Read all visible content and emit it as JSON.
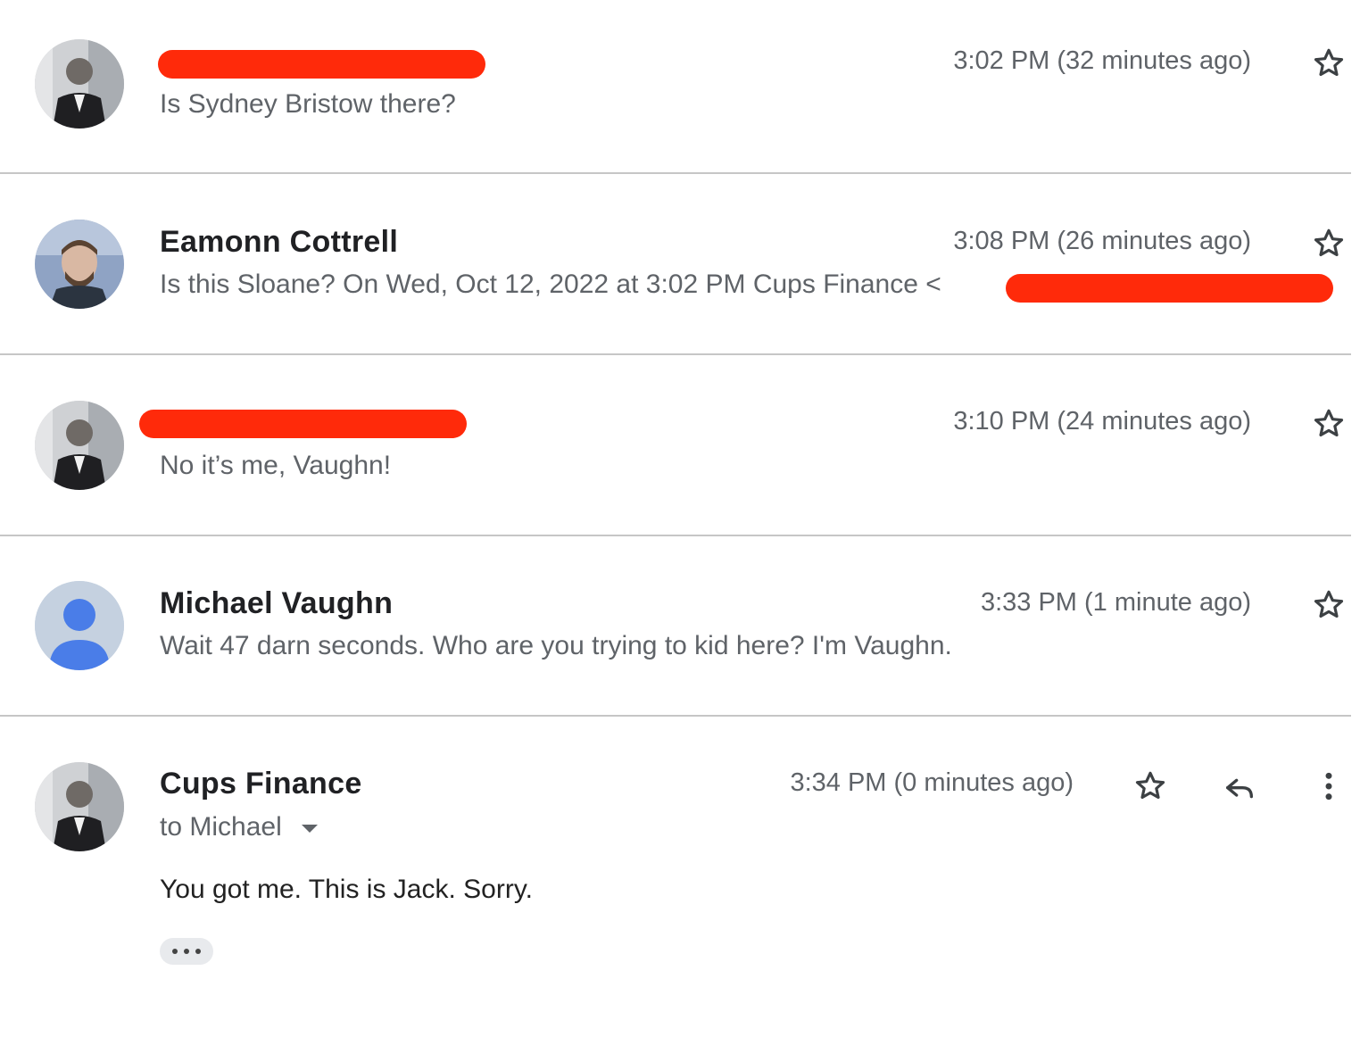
{
  "messages": [
    {
      "sender": "",
      "snippet": "Is Sydney Bristow there?",
      "time": "3:02 PM (32 minutes ago)",
      "avatar": "photo-icon",
      "sender_redacted": true
    },
    {
      "sender": "Eamonn Cottrell",
      "snippet": "Is this Sloane? On Wed, Oct 12, 2022 at 3:02 PM Cups Finance <",
      "time": "3:08 PM (26 minutes ago)",
      "avatar": "photo-icon",
      "email_redacted": true
    },
    {
      "sender": "",
      "snippet": "No it’s me, Vaughn!",
      "time": "3:10 PM (24 minutes ago)",
      "avatar": "photo-icon",
      "sender_redacted": true
    },
    {
      "sender": "Michael Vaughn",
      "snippet": "Wait 47 darn seconds. Who are you trying to kid here? I'm Vaughn.",
      "time": "3:33 PM (1 minute ago)",
      "avatar": "default-person-icon"
    },
    {
      "sender": "Cups Finance",
      "to_line": "to Michael",
      "time": "3:34 PM (0 minutes ago)",
      "body": "You got me. This is Jack. Sorry.",
      "avatar": "photo-icon"
    }
  ],
  "colors": {
    "redaction": "#ff2a0a",
    "default_avatar_bg": "#c5d1e0",
    "default_avatar_fg": "#4a7de8",
    "divider": "#c6c6c6"
  },
  "icons": [
    "star-icon",
    "reply-icon",
    "more-vert-icon",
    "dropdown-arrow-icon",
    "ellipsis-icon"
  ]
}
